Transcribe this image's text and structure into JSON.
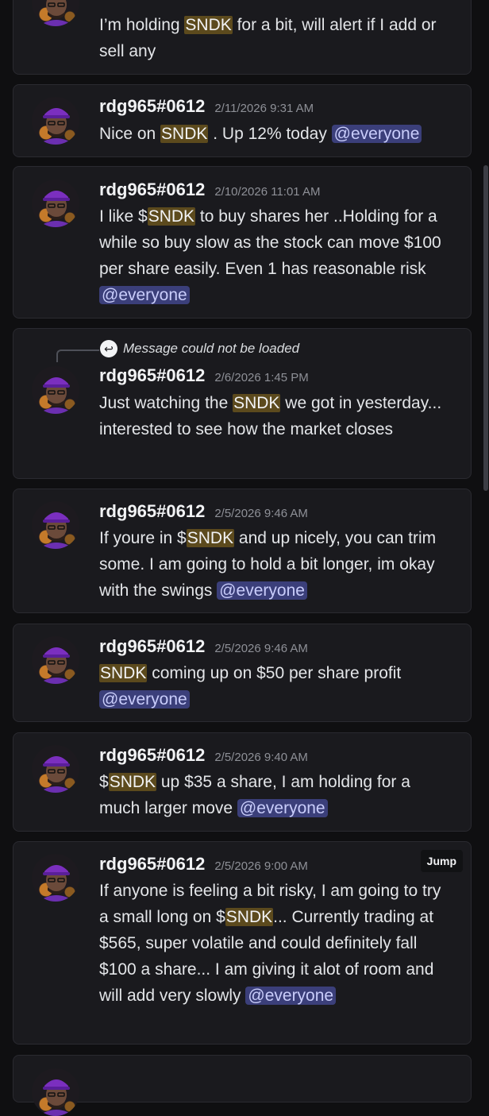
{
  "messages": [
    {
      "body": [
        {
          "t": "I’m holding "
        },
        {
          "t": "SNDK",
          "hl": true
        },
        {
          "t": " for a bit, will alert if I add or sell any"
        }
      ]
    },
    {
      "username": "rdg965#0612",
      "timestamp": "2/11/2026 9:31 AM",
      "body": [
        {
          "t": "Nice on "
        },
        {
          "t": "SNDK",
          "hl": true
        },
        {
          "t": " . Up 12% today "
        },
        {
          "t": "@everyone",
          "mention": true
        }
      ]
    },
    {
      "username": "rdg965#0612",
      "timestamp": "2/10/2026 11:01 AM",
      "body": [
        {
          "t": "I like $"
        },
        {
          "t": "SNDK",
          "hl": true
        },
        {
          "t": " to buy shares her ..Holding for a while so buy slow as the stock can move $100 per share easily. Even 1 has reasonable risk "
        },
        {
          "t": "@everyone",
          "mention": true
        }
      ]
    },
    {
      "reply": "Message could not be loaded",
      "username": "rdg965#0612",
      "timestamp": "2/6/2026 1:45 PM",
      "body": [
        {
          "t": "Just watching the "
        },
        {
          "t": "SNDK",
          "hl": true
        },
        {
          "t": " we got in yesterday... interested to see how the market closes"
        }
      ]
    },
    {
      "username": "rdg965#0612",
      "timestamp": "2/5/2026 9:46 AM",
      "body": [
        {
          "t": "If youre in $"
        },
        {
          "t": "SNDK",
          "hl": true
        },
        {
          "t": " and up nicely, you can trim some. I am going to hold a bit longer, im okay with the swings "
        },
        {
          "t": "@everyone",
          "mention": true
        }
      ]
    },
    {
      "username": "rdg965#0612",
      "timestamp": "2/5/2026 9:46 AM",
      "body": [
        {
          "t": "SNDK",
          "hl": true
        },
        {
          "t": " coming up on $50 per share profit "
        },
        {
          "t": "@everyone",
          "mention": true
        }
      ]
    },
    {
      "username": "rdg965#0612",
      "timestamp": "2/5/2026 9:40 AM",
      "body": [
        {
          "t": "$"
        },
        {
          "t": "SNDK",
          "hl": true
        },
        {
          "t": " up $35 a share, I am holding for a much larger move "
        },
        {
          "t": "@everyone",
          "mention": true
        }
      ]
    },
    {
      "username": "rdg965#0612",
      "timestamp": "2/5/2026 9:00 AM",
      "jump_label": "Jump",
      "body": [
        {
          "t": "If anyone is feeling a bit risky, I am going to try a small long on $"
        },
        {
          "t": "SNDK",
          "hl": true
        },
        {
          "t": "... Currently trading at $565, super volatile and could definitely fall $100 a share... I am giving it alot of room and will add very slowly "
        },
        {
          "t": "@everyone",
          "mention": true
        }
      ]
    }
  ],
  "colors": {
    "background": "#0f0f11",
    "card": "#1a1a1e",
    "highlight": "#5c4a1d",
    "mention_bg": "#3b3f7a",
    "mention_text": "#c9cdfb"
  }
}
